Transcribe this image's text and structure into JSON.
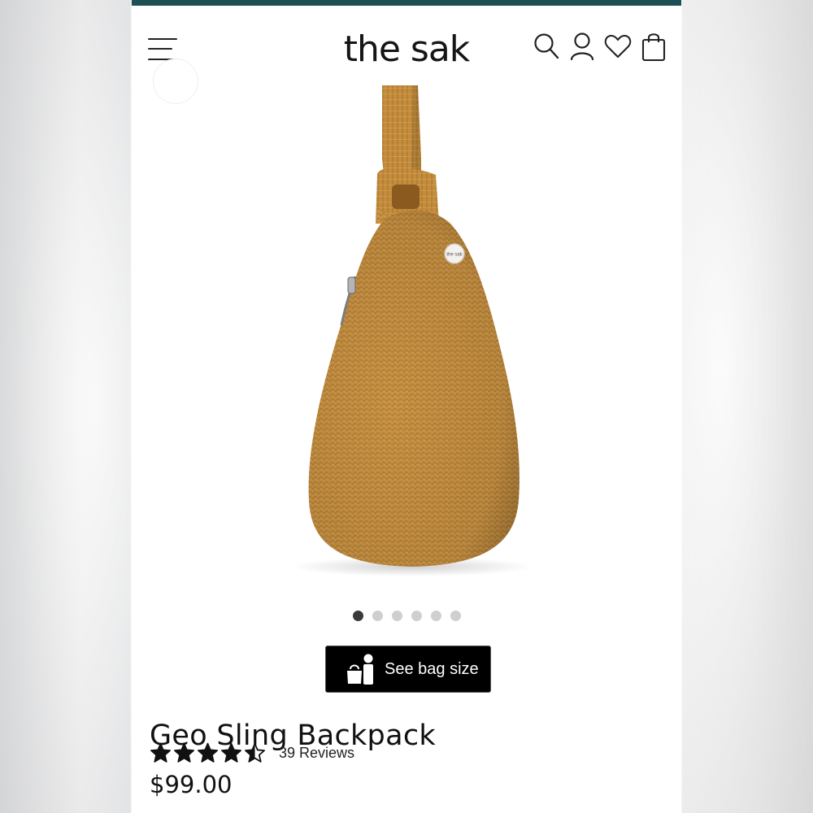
{
  "header": {
    "logo_text": "the sak",
    "menu_icon": "hamburger-menu-icon",
    "icons": [
      "search-icon",
      "account-icon",
      "wishlist-heart-icon",
      "shopping-bag-icon"
    ]
  },
  "colors": {
    "top_strip": "#1d4f54",
    "bag": "#c99243",
    "button_bg": "#000000"
  },
  "gallery": {
    "dot_count": 6,
    "active_index": 0,
    "bag_tag_text": "the sak"
  },
  "size_button": {
    "label": "See bag size",
    "icon": "bag-person-icon"
  },
  "product": {
    "title": "Geo Sling Backpack",
    "rating": 4.5,
    "reviews_label": "39 Reviews",
    "price": "$99.00"
  }
}
